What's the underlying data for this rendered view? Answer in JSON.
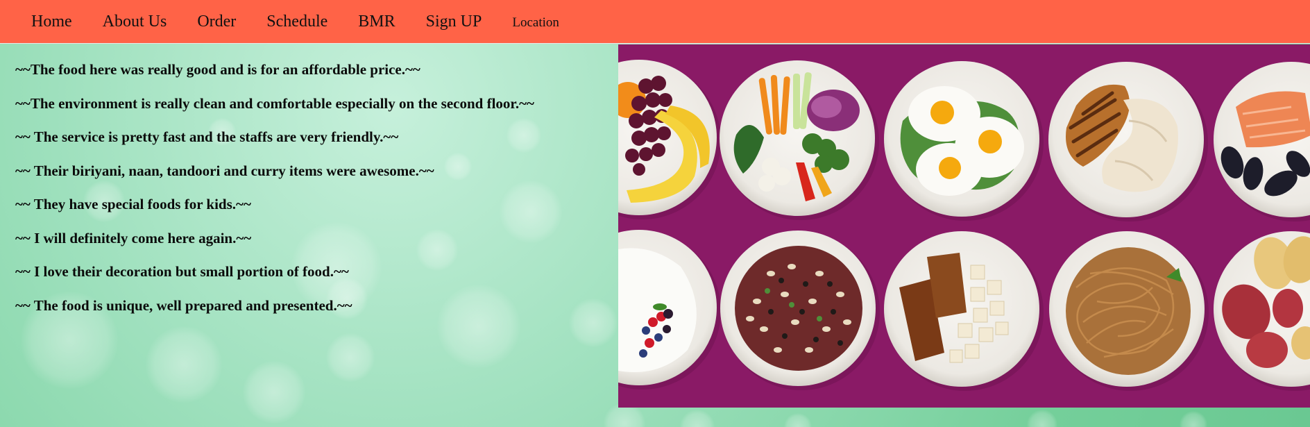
{
  "nav": {
    "items": [
      {
        "label": "Home"
      },
      {
        "label": "About Us"
      },
      {
        "label": "Order"
      },
      {
        "label": "Schedule"
      },
      {
        "label": "BMR"
      },
      {
        "label": "Sign UP"
      },
      {
        "label": "Location"
      }
    ]
  },
  "reviews": [
    "~~The food here was really good and is for an affordable price.~~",
    "~~The environment is really clean and comfortable especially on the second floor.~~",
    "~~ The service is pretty fast and the staffs are very friendly.~~",
    "~~ Their biriyani, naan, tandoori and curry items were awesome.~~",
    "~~ They have special foods for kids.~~",
    "~~ I will definitely come here again.~~",
    "~~ I love their decoration but small portion of food.~~",
    "~~ The food is unique, well prepared and presented.~~"
  ],
  "colors": {
    "navbar": "#ff6347",
    "background": "#74cf9a",
    "food_panel": "#8a1a66"
  },
  "food_image": {
    "plates": [
      "fruit",
      "vegetables",
      "fried-eggs",
      "grilled-chicken-and-turkey",
      "salmon-and-mussels",
      "yogurt-with-berries",
      "bean-salad",
      "tofu-and-tempeh",
      "whole-wheat-spaghetti",
      "potatoes"
    ]
  }
}
